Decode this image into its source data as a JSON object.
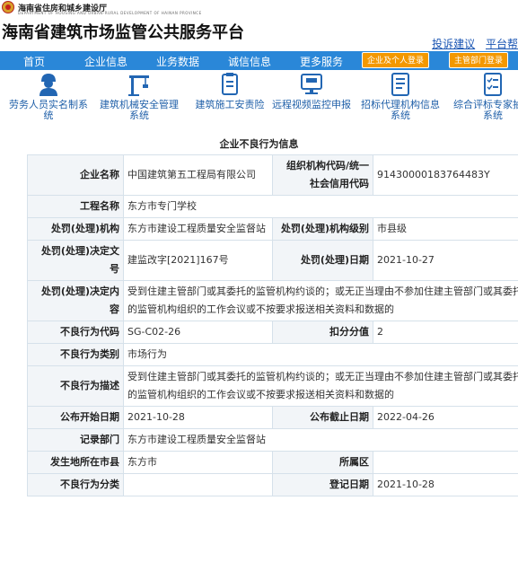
{
  "header": {
    "org_name": "海南省住房和城乡建设厅",
    "org_name_en": "DEPARTMENT OF HOUSING AND URBAN-RURAL DEVELOPMENT OF HAINAN PROVINCE",
    "site_title": "海南省建筑市场监管公共服务平台",
    "links": [
      "投诉建议",
      "平台帮"
    ]
  },
  "nav": {
    "items": [
      "首页",
      "企业信息",
      "业务数据",
      "诚信信息",
      "更多服务"
    ],
    "login_company": "企业及个人登录",
    "login_admin": "主管部门登录"
  },
  "tiles": [
    {
      "label": "劳务人员实名制系统",
      "icon": "worker-icon"
    },
    {
      "label": "建筑机械安全管理系统",
      "icon": "crane-icon"
    },
    {
      "label": "建筑施工安责险",
      "icon": "insurance-doc-icon"
    },
    {
      "label": "远程视频监控申报",
      "icon": "monitor-icon"
    },
    {
      "label": "招标代理机构信息系统",
      "icon": "document-list-icon"
    },
    {
      "label": "综合评标专家抽取系统",
      "icon": "checklist-icon"
    }
  ],
  "section_title": "企业不良行为信息",
  "record": {
    "company_name_label": "企业名称",
    "company_name": "中国建筑第五工程局有限公司",
    "org_code_label": "组织机构代码/统一社会信用代码",
    "org_code": "91430000183764483Y",
    "project_label": "工程名称",
    "project": "东方市专门学校",
    "agency_label": "处罚(处理)机构",
    "agency": "东方市建设工程质量安全监督站",
    "agency_level_label": "处罚(处理)机构级别",
    "agency_level": "市县级",
    "decision_no_label": "处罚(处理)决定文号",
    "decision_no": "建监改字[2021]167号",
    "decision_date_label": "处罚(处理)日期",
    "decision_date": "2021-10-27",
    "decision_content_label": "处罚(处理)决定内容",
    "decision_content": "受到住建主管部门或其委托的监管机构约谈的；或无正当理由不参加住建主管部门或其委托的监管机构组织的工作会议或不按要求报送相关资料和数据的",
    "behavior_code_label": "不良行为代码",
    "behavior_code": "SG-C02-26",
    "deduction_label": "扣分分值",
    "deduction": "2",
    "behavior_type_label": "不良行为类别",
    "behavior_type": "市场行为",
    "behavior_desc_label": "不良行为描述",
    "behavior_desc": "受到住建主管部门或其委托的监管机构约谈的；或无正当理由不参加住建主管部门或其委托的监管机构组织的工作会议或不按要求报送相关资料和数据的",
    "publish_start_label": "公布开始日期",
    "publish_start": "2021-10-28",
    "publish_end_label": "公布截止日期",
    "publish_end": "2022-04-26",
    "record_dept_label": "记录部门",
    "record_dept": "东方市建设工程质量安全监督站",
    "city_label": "发生地所在市县",
    "city": "东方市",
    "district_label": "所属区",
    "district": "",
    "category_label": "不良行为分类",
    "category": "",
    "register_date_label": "登记日期",
    "register_date": "2021-10-28"
  }
}
